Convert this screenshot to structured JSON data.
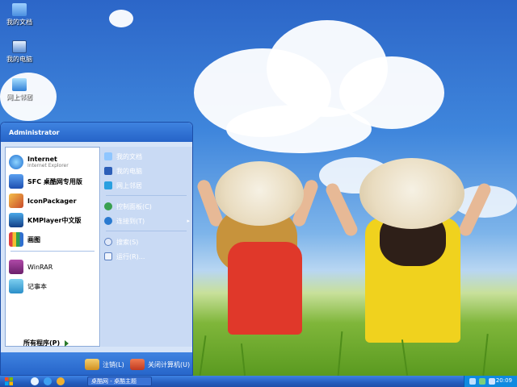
{
  "desktop": {
    "icons": [
      {
        "label": "我的文档",
        "icon": "folder-icon"
      },
      {
        "label": "我的电脑",
        "icon": "computer-icon"
      },
      {
        "label": "网上邻居",
        "icon": "network-icon"
      }
    ]
  },
  "start_menu": {
    "user_name": "Administrator",
    "pinned": [
      {
        "title": "Internet",
        "subtitle": "Internet Explorer",
        "icon": "ie-icon"
      },
      {
        "title": "SFC 桌酷网专用版",
        "icon": "sfc-icon"
      },
      {
        "title": "IconPackager",
        "icon": "iconpackager-icon"
      },
      {
        "title": "KMPlayer中文版",
        "icon": "kmplayer-icon"
      },
      {
        "title": "画图",
        "icon": "paint-icon"
      },
      {
        "title": "WinRAR",
        "icon": "winrar-icon"
      },
      {
        "title": "记事本",
        "icon": "notepad-icon"
      }
    ],
    "all_programs": "所有程序(P)",
    "places": [
      {
        "label": "我的文档",
        "icon": "documents-icon"
      },
      {
        "label": "我的电脑",
        "icon": "computer-icon"
      },
      {
        "label": "网上邻居",
        "icon": "network-icon"
      },
      {
        "label": "控制面板(C)",
        "icon": "control-panel-icon"
      },
      {
        "label": "连接到(T)",
        "icon": "connect-icon"
      },
      {
        "label": "搜索(S)",
        "icon": "search-icon"
      },
      {
        "label": "运行(R)...",
        "icon": "run-icon"
      }
    ],
    "logoff": "注销(L)",
    "shutdown": "关闭计算机(U)"
  },
  "taskbar": {
    "task_label": "桌酷网 - 桌酷主题",
    "clock": "20:09"
  },
  "colors": {
    "taskbar_blue": "#245ebf",
    "tray_blue": "#0f8ae0",
    "menu_header": "#2563c8"
  }
}
